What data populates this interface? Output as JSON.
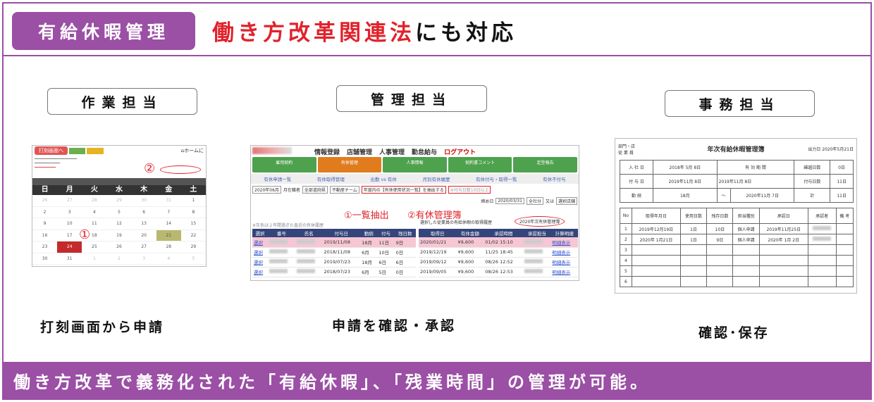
{
  "header": {
    "tag": "有給休暇管理",
    "headline_red": "働き方改革関連法",
    "headline_black": "にも対応"
  },
  "roles": [
    {
      "title": "作業担当",
      "caption": "打刻画面から申請"
    },
    {
      "title": "管理担当",
      "caption": "申請を確認・承認"
    },
    {
      "title": "事務担当",
      "caption": "確認･保存"
    }
  ],
  "footer": "働き方改革で義務化された「有給休暇」、「残業時間」の管理が可能。",
  "calendar": {
    "punch_button": "打刻画面へ",
    "home": "ホームに",
    "weekdays": [
      "日",
      "月",
      "火",
      "水",
      "木",
      "金",
      "土"
    ],
    "days": [
      "26",
      "27",
      "28",
      "29",
      "30",
      "31",
      "1",
      "2",
      "3",
      "4",
      "5",
      "6",
      "7",
      "8",
      "9",
      "10",
      "11",
      "12",
      "13",
      "14",
      "15",
      "16",
      "17",
      "18",
      "19",
      "20",
      "21",
      "22",
      "23",
      "24",
      "25",
      "26",
      "27",
      "28",
      "29",
      "30",
      "31",
      "1",
      "2",
      "3",
      "4",
      "5"
    ],
    "annotation_1": "①",
    "annotation_2": "②"
  },
  "management": {
    "menu": [
      "情報登録",
      "店舗管理",
      "人事管理",
      "勤怠給与",
      "ログアウト"
    ],
    "tabs": [
      "雇用契約",
      "有休管理",
      "人事情報",
      "契約書コメント",
      "定型報告"
    ],
    "subnav": [
      "有休申請一覧",
      "有休取得管理",
      "出勤 vs 有休",
      "月別有休履歴",
      "有休付与・取得一覧",
      "有休不付与"
    ],
    "month_select": "2020年06月",
    "status_label": "月在職者",
    "region_select": "全部道府県",
    "team_select": "不動産チーム",
    "extract_button": "年度内の【有休使用状況一覧】を抽出する",
    "grant_note": "※付与日数10日以上",
    "date_label": "締め日",
    "date_value": "2020/03/31",
    "all_company": "全社分",
    "or": "又は",
    "select_store": "選択店舗",
    "note_left": "※灰色は２年間過ぎた直近の有休履歴",
    "note_right": "選択した従業員の有給休暇の取得履歴",
    "ledger_button": "2020年次有休管理簿",
    "anno_1": "①一覧抽出",
    "anno_2": "②有休管理簿",
    "left_headers": [
      "選択",
      "番号",
      "氏名",
      "付与日",
      "勤続",
      "付与",
      "残日数"
    ],
    "left_rows": [
      {
        "sel": "選択",
        "date": "2019/11/08",
        "tenure": "18月",
        "grant": "11日",
        "remain": "9日"
      },
      {
        "sel": "選択",
        "date": "2018/11/08",
        "tenure": "6月",
        "grant": "10日",
        "remain": "0日"
      },
      {
        "sel": "選択",
        "date": "2019/07/23",
        "tenure": "18月",
        "grant": "6日",
        "remain": "6日"
      },
      {
        "sel": "選択",
        "date": "2018/07/23",
        "tenure": "6月",
        "grant": "5日",
        "remain": "0日"
      }
    ],
    "right_headers": [
      "取得日",
      "有休金額",
      "承認時間",
      "承認担当",
      "計算明細"
    ],
    "right_rows": [
      {
        "date": "2020/01/21",
        "amount": "¥9,600",
        "time": "01/02 15:10",
        "detail": "明細表示"
      },
      {
        "date": "2019/12/19",
        "amount": "¥9,600",
        "time": "11/25 18:45",
        "detail": "明細表示"
      },
      {
        "date": "2019/09/12",
        "amount": "¥9,600",
        "time": "08/26 12:52",
        "detail": "明細表示"
      },
      {
        "date": "2019/09/05",
        "amount": "¥9,600",
        "time": "08/26 12:53",
        "detail": "明細表示"
      }
    ]
  },
  "ledger": {
    "title": "年次有給休暇管理簿",
    "output_date": "出力日 2020年5月21日",
    "dept_label": "部門・店",
    "employee_label": "従 業 員",
    "hire_label": "入 社 日",
    "hire_value": "2018年 5月 8日",
    "valid_label": "有 効 期 間",
    "carry_label": "繰越日数",
    "carry_value": "0日",
    "grant_label": "付 与 日",
    "grant_value": "2019年11月 8日",
    "grant_value2": "2019年11月 8日",
    "grant_days_label": "付与日数",
    "grant_days_value": "11日",
    "tenure_label": "勤 続",
    "tenure_value": "18月",
    "tilde": "～",
    "end_value": "2020年11月 7日",
    "total_label": "計",
    "total_value": "11日",
    "col_headers": [
      "No",
      "取得年月日",
      "使用日数",
      "残存日数",
      "担当種別",
      "承認日",
      "承認者",
      "備 考"
    ],
    "rows": [
      {
        "no": "1",
        "date": "2019年12月19日",
        "used": "1日",
        "remain": "10日",
        "type": "個人申請",
        "approved": "2019年11月25日"
      },
      {
        "no": "2",
        "date": "2020年 1月21日",
        "used": "1日",
        "remain": "9日",
        "type": "個人申請",
        "approved": "2020年 1月 2日"
      },
      {
        "no": "3"
      },
      {
        "no": "4"
      },
      {
        "no": "5"
      },
      {
        "no": "6"
      }
    ]
  },
  "colors": {
    "accent": "#9b4fa5",
    "red": "#e0232c",
    "table_header": "#33457a"
  }
}
